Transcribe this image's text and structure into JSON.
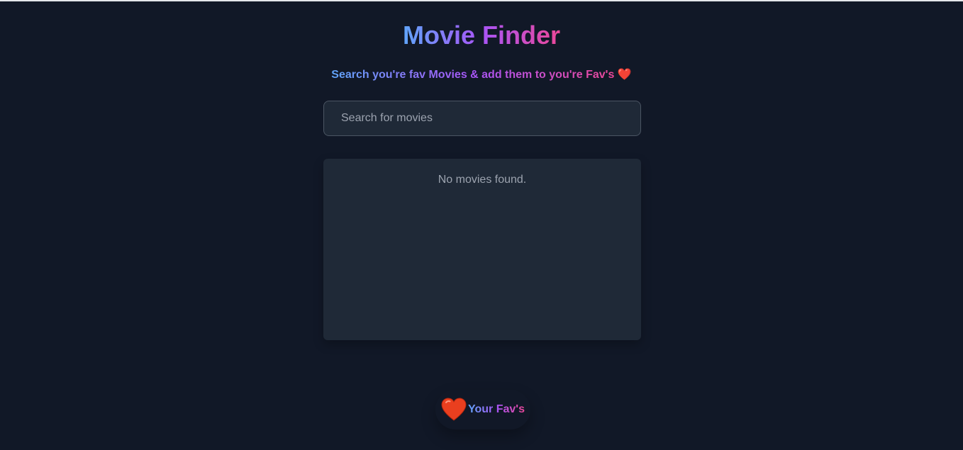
{
  "app": {
    "title": "Movie Finder",
    "subtitle": "Search you're fav Movies & add them to you're Fav's",
    "subtitle_icon": "heart-emoji",
    "colors": {
      "background": "#111827",
      "panel": "#1f2937",
      "gradient": [
        "#60a5fa",
        "#a855f7",
        "#ec4899"
      ],
      "heart": "#ef4444"
    }
  },
  "search": {
    "placeholder": "Search for movies",
    "value": ""
  },
  "results": {
    "empty_message": "No movies found."
  },
  "favorites": {
    "label": "Your Fav's",
    "icon": "heart-icon"
  }
}
